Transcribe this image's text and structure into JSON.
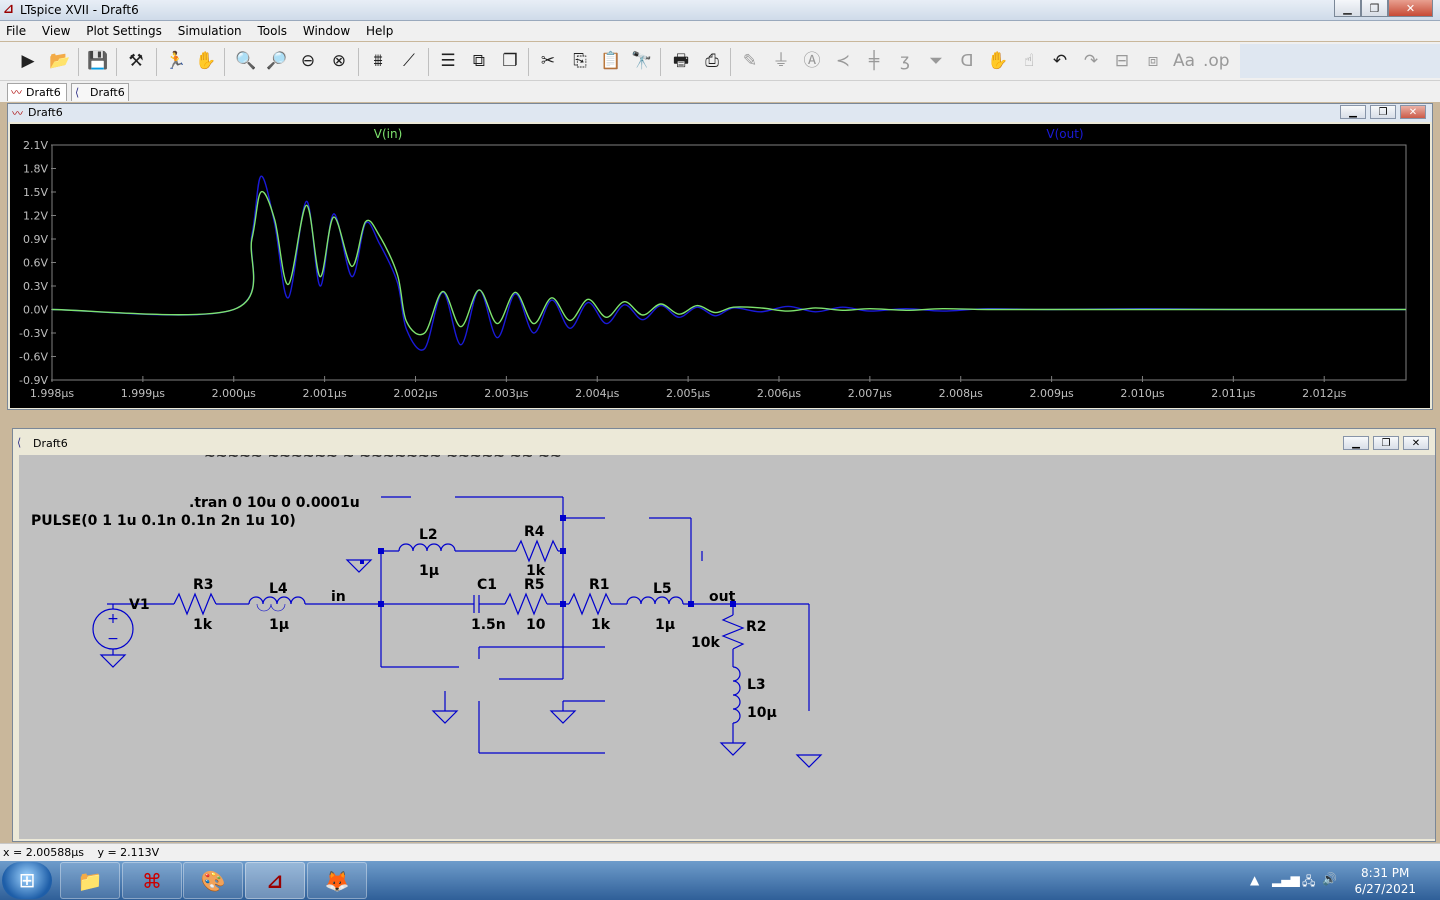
{
  "window": {
    "title": "LTspice XVII - Draft6",
    "app_icon": "ltspice-icon"
  },
  "menu": [
    "File",
    "View",
    "Plot Settings",
    "Simulation",
    "Tools",
    "Window",
    "Help"
  ],
  "tabs": [
    {
      "label": "Draft6",
      "icon": "waveform-icon"
    },
    {
      "label": "Draft6",
      "icon": "schematic-icon"
    }
  ],
  "waveform_window": {
    "title": "Draft6"
  },
  "schematic_window": {
    "title": "Draft6"
  },
  "colors": {
    "vin_trace": "#7ee36e",
    "vout_trace": "#1a1ad8",
    "wire": "#0000cc",
    "plot_bg": "#000000",
    "sch_bg": "#c0c0c0"
  },
  "chart_data": {
    "type": "line",
    "title": "",
    "xlabel": "",
    "ylabel": "",
    "xlim": [
      1.998,
      2.0129
    ],
    "ylim": [
      -0.9,
      2.1
    ],
    "x_ticks": [
      "1.998µs",
      "1.999µs",
      "2.000µs",
      "2.001µs",
      "2.002µs",
      "2.003µs",
      "2.004µs",
      "2.005µs",
      "2.006µs",
      "2.007µs",
      "2.008µs",
      "2.009µs",
      "2.010µs",
      "2.011µs",
      "2.012µs"
    ],
    "y_ticks": [
      "2.1V",
      "1.8V",
      "1.5V",
      "1.2V",
      "0.9V",
      "0.6V",
      "0.3V",
      "0.0V",
      "-0.3V",
      "-0.6V",
      "-0.9V"
    ],
    "series": [
      {
        "name": "V(in)",
        "color": "#7ee36e",
        "x": [
          1.998,
          2.0,
          2.0002,
          2.0003,
          2.00045,
          2.0006,
          2.0008,
          2.00095,
          2.0011,
          2.0013,
          2.00145,
          2.0016,
          2.0018,
          2.0019,
          2.0021,
          2.0023,
          2.0025,
          2.0027,
          2.0029,
          2.0031,
          2.0033,
          2.0035,
          2.0037,
          2.0039,
          2.0041,
          2.0043,
          2.0045,
          2.0047,
          2.0049,
          2.0051,
          2.0053,
          2.0055,
          2.0058,
          2.0061,
          2.0064,
          2.0067,
          2.007,
          2.0074,
          2.0078,
          2.0083,
          2.009,
          2.01,
          2.011,
          2.0129
        ],
        "y": [
          0,
          0,
          0.9,
          1.5,
          1.15,
          0.32,
          1.33,
          0.42,
          1.18,
          0.55,
          1.12,
          0.95,
          0.45,
          -0.15,
          -0.3,
          0.23,
          -0.22,
          0.25,
          -0.18,
          0.22,
          -0.18,
          0.15,
          -0.14,
          0.13,
          -0.1,
          0.1,
          -0.07,
          0.07,
          -0.06,
          0.05,
          -0.04,
          0.03,
          0.02,
          -0.02,
          0.02,
          -0.01,
          0.01,
          -0.01,
          0.01,
          0,
          0,
          0,
          0,
          0
        ]
      },
      {
        "name": "V(out)",
        "color": "#1a1ad8",
        "x": [
          1.998,
          2.0,
          2.0002,
          2.0003,
          2.00045,
          2.0006,
          2.0008,
          2.00095,
          2.0011,
          2.0013,
          2.00145,
          2.0016,
          2.0018,
          2.0019,
          2.0021,
          2.0023,
          2.0025,
          2.0027,
          2.0029,
          2.0031,
          2.0033,
          2.0035,
          2.0037,
          2.0039,
          2.0041,
          2.0043,
          2.0045,
          2.0047,
          2.0049,
          2.0051,
          2.0053,
          2.0055,
          2.0058,
          2.0061,
          2.0064,
          2.0067,
          2.007,
          2.0074,
          2.0078,
          2.0083,
          2.009,
          2.01,
          2.011,
          2.0129
        ],
        "y": [
          0,
          0,
          0.95,
          1.7,
          1.1,
          0.15,
          1.38,
          0.3,
          1.22,
          0.42,
          1.1,
          0.85,
          0.35,
          -0.25,
          -0.5,
          0.22,
          -0.45,
          0.25,
          -0.36,
          0.2,
          -0.3,
          0.12,
          -0.24,
          0.09,
          -0.18,
          0.06,
          -0.13,
          0.05,
          -0.1,
          0.03,
          -0.08,
          0.02,
          -0.03,
          0.04,
          -0.03,
          0.03,
          -0.02,
          0.01,
          -0.02,
          0.01,
          0,
          0.01,
          0,
          0
        ]
      }
    ]
  },
  "schematic": {
    "tran_directive": ".tran 0 10u 0 0.0001u",
    "pulse_text": "PULSE(0 1 1u 0.1n 0.1n 2n 1u 10)",
    "partial_text": "~~~~~ ~~~~~~ ~ ~~~~~~~ ~~~~~ ~~ ~~",
    "source_name": "V1",
    "net_in": "in",
    "net_out": "out",
    "components": [
      {
        "ref": "R3",
        "value": "1k"
      },
      {
        "ref": "L4",
        "value": "1µ"
      },
      {
        "ref": "L2",
        "value": "1µ"
      },
      {
        "ref": "R4",
        "value": "1k"
      },
      {
        "ref": "C1",
        "value": "1.5n"
      },
      {
        "ref": "R5",
        "value": "10"
      },
      {
        "ref": "R1",
        "value": "1k"
      },
      {
        "ref": "L5",
        "value": "1µ"
      },
      {
        "ref": "R2",
        "value": "10k"
      },
      {
        "ref": "L3",
        "value": "10µ"
      }
    ]
  },
  "status": {
    "x": "x = 2.00588µs",
    "y": "y = 2.113V"
  },
  "taskbar": {
    "apps": [
      "explorer-icon",
      "acrobat-icon",
      "paint-icon",
      "ltspice-icon",
      "firefox-icon"
    ],
    "time": "8:31 PM",
    "date": "6/27/2021"
  }
}
